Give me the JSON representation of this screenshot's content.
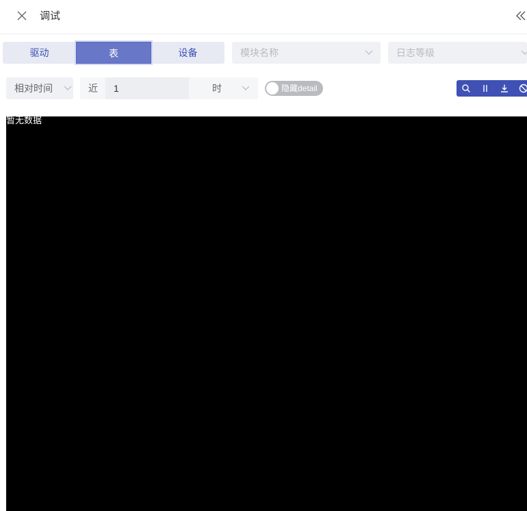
{
  "header": {
    "title": "调试"
  },
  "tabs": [
    {
      "label": "驱动",
      "active": false
    },
    {
      "label": "表",
      "active": true
    },
    {
      "label": "设备",
      "active": false
    }
  ],
  "filters": {
    "module_placeholder": "模块名称",
    "log_level_placeholder": "日志等级",
    "time_mode": "相对时间",
    "near_label": "近",
    "near_value": "1",
    "unit": "时"
  },
  "toggle": {
    "label": "隐藏detail",
    "checked": false
  },
  "console": {
    "empty_text": "暂无数据"
  },
  "colors": {
    "accent": "#3f51b5",
    "tab_active_bg": "#6877c7",
    "console_bg": "#000000"
  }
}
